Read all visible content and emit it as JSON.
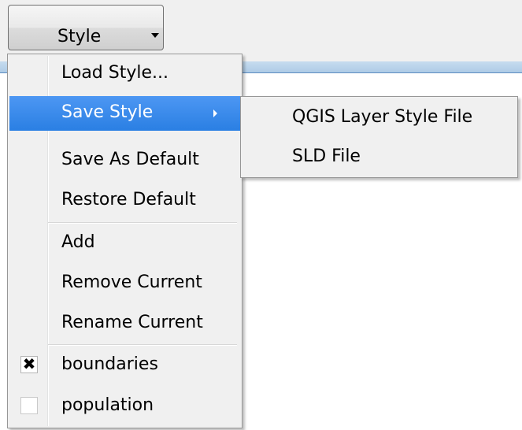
{
  "toolbar": {
    "style_button_label": "Style"
  },
  "menu": {
    "items": [
      {
        "label": "Load Style..."
      },
      {
        "label": "Save Style"
      },
      {
        "label": "Save As Default"
      },
      {
        "label": "Restore Default"
      },
      {
        "label": "Add"
      },
      {
        "label": "Remove Current"
      },
      {
        "label": "Rename Current"
      },
      {
        "label": "boundaries",
        "checked": true
      },
      {
        "label": "population",
        "checked": false
      }
    ]
  },
  "submenu": {
    "items": [
      {
        "label": "QGIS Layer Style File"
      },
      {
        "label": "SLD File"
      }
    ]
  },
  "colors": {
    "highlight": "#3a8ae9",
    "menu_bg": "#f0f0f0",
    "accent_line": "#5b8cc0"
  }
}
